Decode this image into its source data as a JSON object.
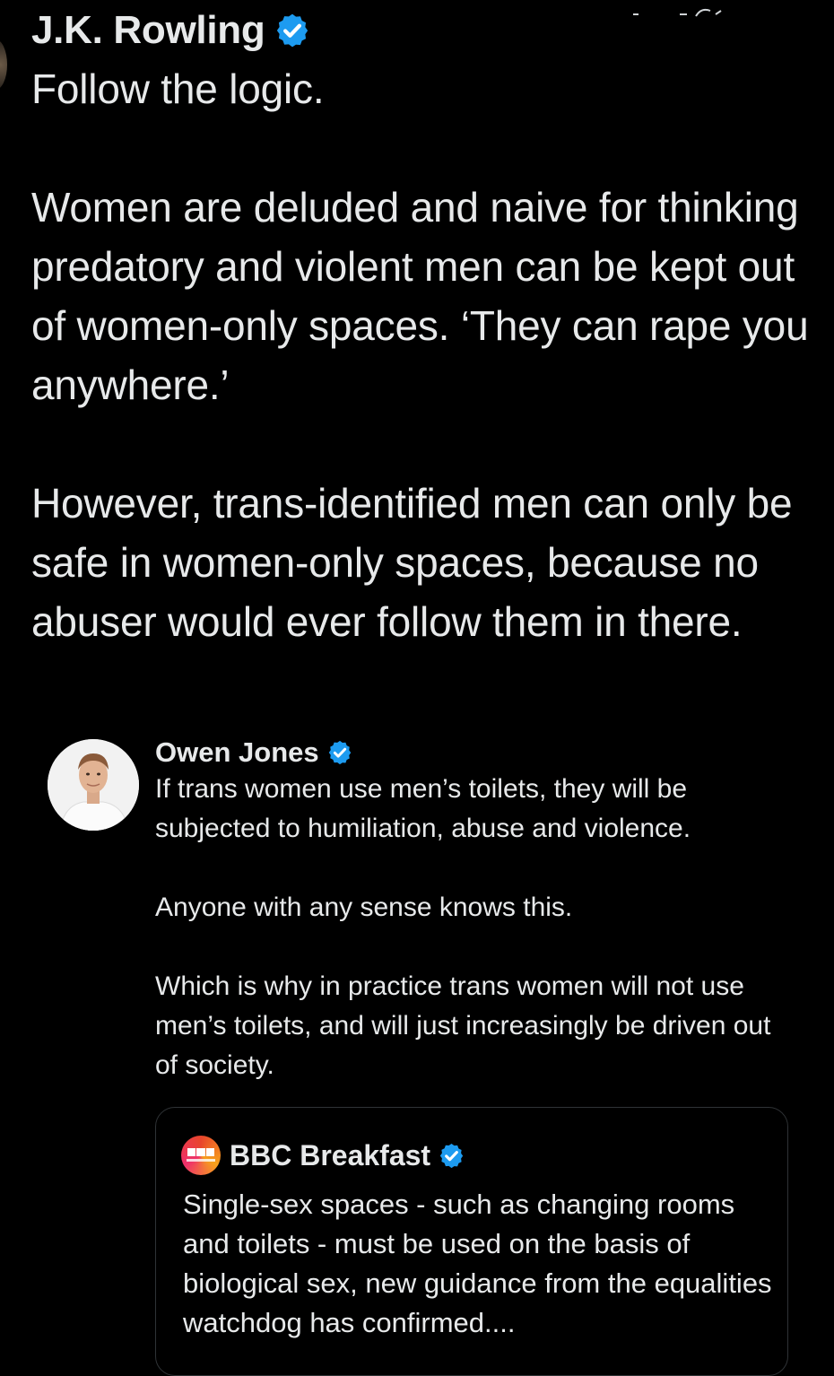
{
  "colors": {
    "background": "#000000",
    "text": "#e7e9ea",
    "verified_badge": "#1d9bf0",
    "card_border": "#2f3336"
  },
  "tweet": {
    "author": "J.K. Rowling",
    "verified_icon": "verified-badge-icon",
    "paragraphs": [
      "Follow the logic.",
      "Women are deluded and naive for thinking predatory and violent men can be kept out of women-only spaces. ‘They can rape you anywhere.’",
      "However, trans-identified men can only be safe in women-only spaces, because no abuser would ever follow them in there."
    ]
  },
  "quoted_tweet": {
    "author": "Owen Jones",
    "verified_icon": "verified-badge-icon",
    "paragraphs": [
      "If trans women use men’s toilets, they will be subjected to humiliation, abuse and violence.",
      "Anyone with any sense knows this.",
      "Which is why in practice trans women will not use men’s toilets, and will just increasingly be driven out of society."
    ]
  },
  "nested_quote": {
    "author": "BBC Breakfast",
    "logo_icon": "bbc-breakfast-logo-icon",
    "verified_icon": "verified-badge-icon",
    "text": "Single-sex spaces - such as changing rooms and toilets - must be used on the basis of biological sex, new guidance from the equalities watchdog has confirmed...."
  }
}
